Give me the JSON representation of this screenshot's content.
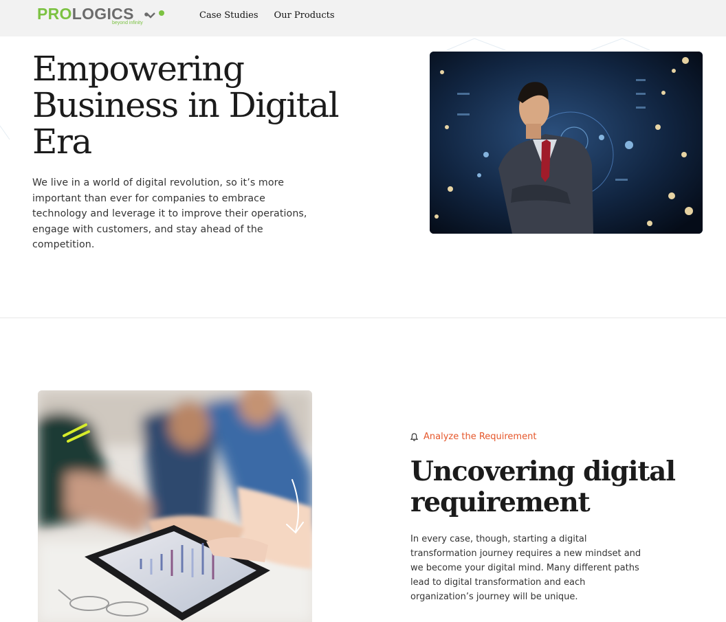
{
  "header": {
    "logo": {
      "brand_green": "PRO",
      "brand_gray": "LOGICS",
      "tagline": "beyond infinity"
    },
    "nav": [
      {
        "label": "Case Studies"
      },
      {
        "label": "Our Products"
      }
    ]
  },
  "hero": {
    "title_lines": [
      "Empowering",
      "Business in Digital",
      "Era"
    ],
    "description": "We live in a world of digital revolution, so it’s more important than ever for companies to embrace technology and leverage it to improve their operations, engage with customers, and stay ahead of the competition.",
    "image": "businessman-digital-interface"
  },
  "section": {
    "label": "Analyze the Requirement",
    "label_icon": "bell-icon",
    "title_lines": [
      "Uncovering digital",
      "requirement"
    ],
    "description": "In every case, though, starting a digital transformation journey requires a new mindset and we become your digital mind. Many different paths lead to digital transformation and each organization’s journey will be unique.",
    "image": "team-tablet-chart"
  },
  "colors": {
    "brand_green": "#7cc242",
    "brand_gray": "#6b6b6b",
    "accent_orange": "#e5562a",
    "header_bg": "#f2f2f2"
  }
}
